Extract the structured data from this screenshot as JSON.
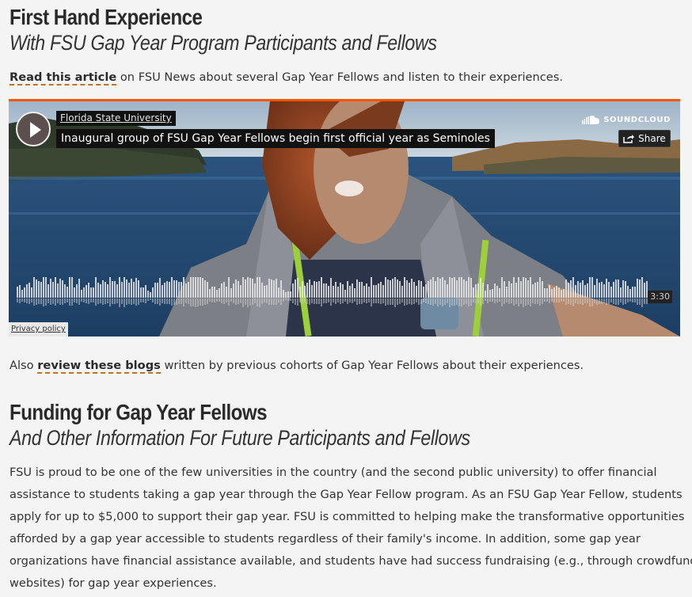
{
  "section1": {
    "title": "First Hand Experience",
    "subtitle": "With FSU Gap Year Program Participants and Fellows",
    "intro_link": "Read this article",
    "intro_rest": " on FSU News about several Gap Year Fellows and listen to their experiences."
  },
  "player": {
    "artist": "Florida State University",
    "track_title": "Inaugural group of FSU Gap Year Fellows begin first official year as Seminoles",
    "brand": "SOUNDCLOUD",
    "share_label": "Share",
    "duration": "3:30",
    "privacy": "Privacy policy",
    "icons": {
      "play": "play-icon",
      "brand": "soundcloud-icon",
      "share": "share-icon"
    },
    "accent_color": "#ff5500"
  },
  "blogs": {
    "before": "Also ",
    "link": "review these blogs",
    "after": " written by previous cohorts of Gap Year Fellows about their experiences."
  },
  "section2": {
    "title": "Funding for Gap Year Fellows",
    "subtitle": "And Other Information For Future Participants and Fellows",
    "lines": [
      "FSU is proud to be one of the few universities in the country (and the second public university) to offer financial",
      "assistance to students taking a gap year through the Gap Year Fellow program. As an FSU Gap Year Fellow, students",
      "apply for up to $5,000 to support their gap year. FSU is committed to helping make the transformative opportunities",
      "afforded by a gap year accessible to students regardless of their family's income. In addition, some gap year",
      "organizations have financial assistance available, and students have had success fundraising (e.g., through crowdfunding",
      "websites) for gap year experiences."
    ]
  },
  "colors": {
    "link_underline": "#c2721f",
    "text": "#333333",
    "background": "#f4f4f4"
  }
}
